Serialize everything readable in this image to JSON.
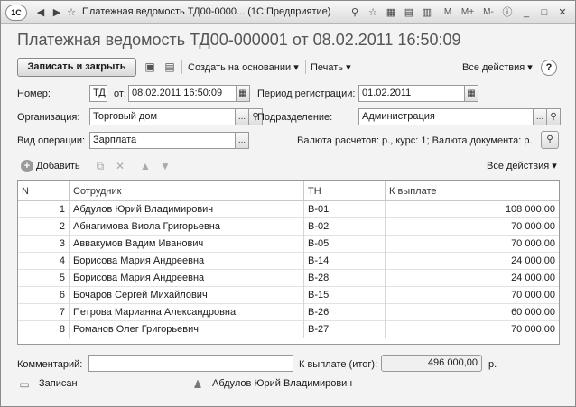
{
  "window": {
    "title": "Платежная ведомость ТД00-0000... (1С:Предприятие)",
    "logo": "1С",
    "right_buttons": [
      "M",
      "M+",
      "M-"
    ]
  },
  "form_title": "Платежная ведомость ТД00-000001 от 08.02.2011 16:50:09",
  "toolbar": {
    "save_close": "Записать и закрыть",
    "create_based_on": "Создать на основании",
    "print": "Печать",
    "all_actions": "Все действия",
    "help": "?"
  },
  "fields": {
    "number_label": "Номер:",
    "number_value": "ТД",
    "date_label": "от:",
    "date_value": "08.02.2011 16:50:09",
    "reg_period_label": "Период регистрации:",
    "reg_period_value": "01.02.2011",
    "org_label": "Организация:",
    "org_value": "Торговый дом",
    "division_label": "Подразделение:",
    "division_value": "Администрация",
    "op_type_label": "Вид операции:",
    "op_type_value": "Зарплата",
    "currency_text": "Валюта расчетов: р., курс: 1; Валюта документа: р."
  },
  "table_toolbar": {
    "add": "Добавить",
    "all_actions": "Все действия"
  },
  "table": {
    "columns": [
      "N",
      "Сотрудник",
      "ТН",
      "К выплате"
    ],
    "rows": [
      {
        "n": "1",
        "employee": "Абдулов Юрий Владимирович",
        "tn": "В-01",
        "amount": "108 000,00"
      },
      {
        "n": "2",
        "employee": "Абнагимова Виола Григорьевна",
        "tn": "В-02",
        "amount": "70 000,00"
      },
      {
        "n": "3",
        "employee": "Аввакумов Вадим Иванович",
        "tn": "В-05",
        "amount": "70 000,00"
      },
      {
        "n": "4",
        "employee": "Борисова Мария Андреевна",
        "tn": "В-14",
        "amount": "24 000,00"
      },
      {
        "n": "5",
        "employee": "Борисова Мария Андреевна",
        "tn": "В-28",
        "amount": "24 000,00"
      },
      {
        "n": "6",
        "employee": "Бочаров Сергей Михайлович",
        "tn": "В-15",
        "amount": "70 000,00"
      },
      {
        "n": "7",
        "employee": "Петрова Марианна Александровна",
        "tn": "В-26",
        "amount": "60 000,00"
      },
      {
        "n": "8",
        "employee": "Романов Олег Григорьевич",
        "tn": "В-27",
        "amount": "70 000,00"
      }
    ]
  },
  "footer": {
    "comment_label": "Комментарий:",
    "comment_value": "",
    "total_label": "К выплате (итог):",
    "total_value": "496 000,00",
    "currency": "р."
  },
  "status": {
    "state": "Записан",
    "user": "Абдулов Юрий Владимирович"
  },
  "icons": {
    "dropdown": "▾",
    "select": "...",
    "calendar": "▦",
    "search": "search-icon"
  }
}
